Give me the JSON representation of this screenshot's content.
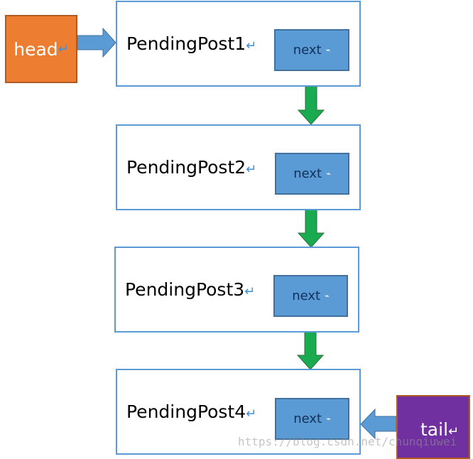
{
  "head": {
    "label": "head",
    "color": "#ed7d31"
  },
  "tail": {
    "label": "tail",
    "color": "#7030a0"
  },
  "nodes": [
    {
      "label": "PendingPost1",
      "next": "next"
    },
    {
      "label": "PendingPost2",
      "next": "next"
    },
    {
      "label": "PendingPost3",
      "next": "next"
    },
    {
      "label": "PendingPost4",
      "next": "next"
    }
  ],
  "return_mark": "↵",
  "watermark": "https://blog.csdn.net/chunqiuwei",
  "colors": {
    "node_border": "#5b9bd5",
    "next_fill": "#5b9bd5",
    "link_arrow": "#1aab50",
    "pointer_arrow": "#5b9bd5"
  }
}
